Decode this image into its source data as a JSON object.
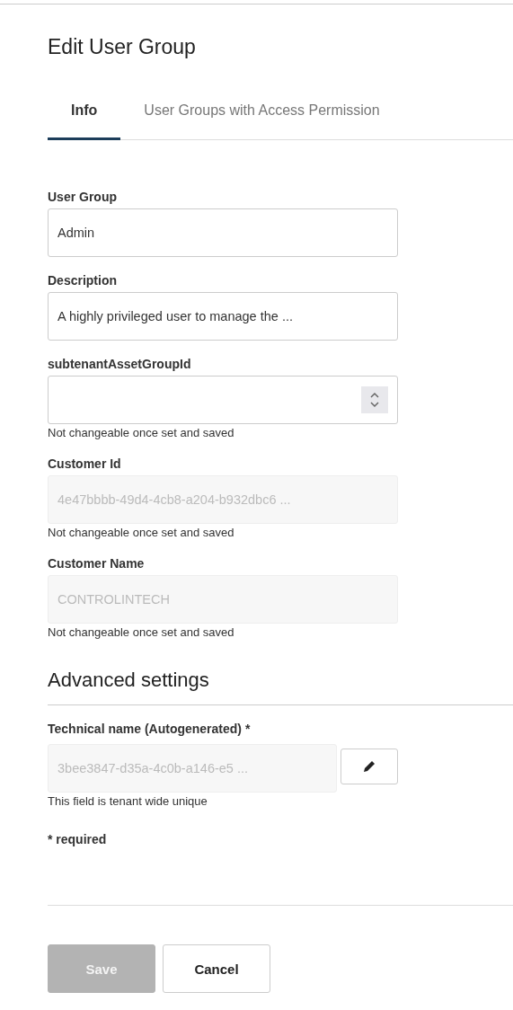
{
  "title": "Edit User Group",
  "tabs": [
    {
      "label": "Info",
      "selected": true
    },
    {
      "label": "User Groups with Access Permission",
      "selected": false
    }
  ],
  "fields": [
    {
      "label": "User Group",
      "kind": "text",
      "value": "Admin",
      "disabled": false
    },
    {
      "label": "Description",
      "kind": "text",
      "value": "A highly privileged user to manage the ...",
      "disabled": false
    },
    {
      "label": "subtenantAssetGroupId",
      "kind": "number",
      "disabled": false,
      "helper": "Not changeable once set and saved"
    },
    {
      "label": "Customer Id",
      "kind": "text",
      "value": "4e47bbbb-49d4-4cb8-a204-b932dbc6 ...",
      "disabled": true,
      "helper": "Not changeable once set and saved"
    },
    {
      "label": "Customer Name",
      "kind": "text",
      "value": "CONTROLINTECH",
      "disabled": true,
      "helper": "Not changeable once set and saved"
    }
  ],
  "advanced": {
    "title": "Advanced settings",
    "label": "Technical name (Autogenerated) *",
    "value": "3bee3847-d35a-4c0b-a146-e5 ...",
    "disabled": true,
    "helper": "This field is tenant wide unique"
  },
  "required_note": "* required",
  "buttons": [
    {
      "label": "Save",
      "kind": "primary",
      "disabled": true
    },
    {
      "label": "Cancel",
      "kind": "secondary",
      "disabled": false
    }
  ]
}
